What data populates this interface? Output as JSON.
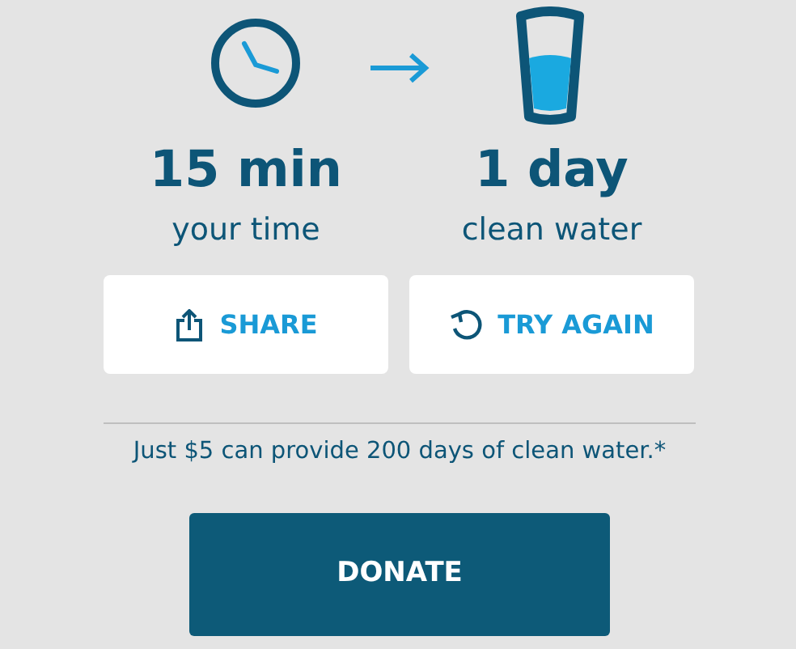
{
  "stats": [
    {
      "value": "15 min",
      "caption": "your time",
      "kind": "clock"
    },
    {
      "value": "1 day",
      "caption": "clean water",
      "kind": "glass"
    }
  ],
  "actions": [
    {
      "kind": "share",
      "label": "SHARE"
    },
    {
      "kind": "retry",
      "label": "TRY AGAIN"
    }
  ],
  "note": "Just $5 can provide 200 days of clean water.*",
  "donate": {
    "label": "DONATE"
  }
}
